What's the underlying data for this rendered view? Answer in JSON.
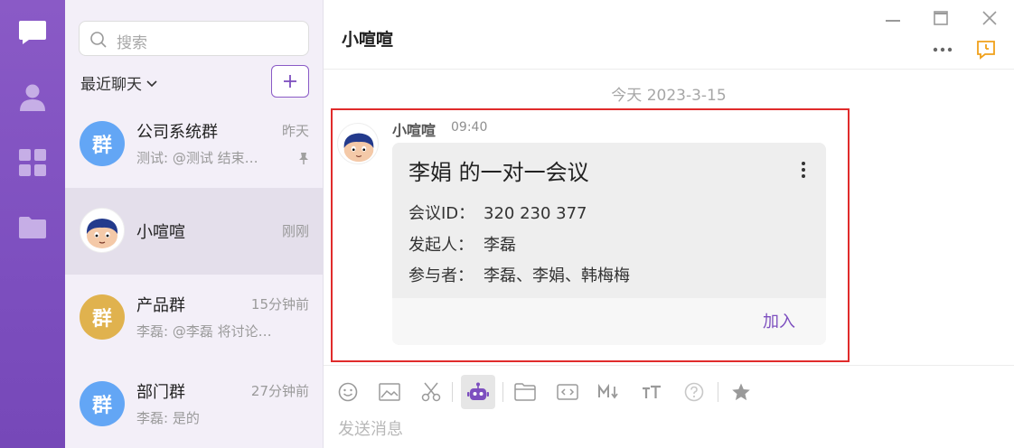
{
  "sidebar": {
    "items": [
      {
        "icon": "chat-icon"
      },
      {
        "icon": "contacts-icon"
      },
      {
        "icon": "apps-icon"
      },
      {
        "icon": "folder-icon"
      }
    ]
  },
  "conversation_list": {
    "search_placeholder": "搜索",
    "filter_label": "最近聊天",
    "add_label": "+",
    "conversations": [
      {
        "avatar_text": "群",
        "avatar_color": "#63a6f5",
        "name": "公司系统群",
        "time": "昨天",
        "preview": "测试: @测试 结束…",
        "pinned": true
      },
      {
        "avatar_text": "",
        "avatar_color": "#ffffff",
        "name": "小喧喧",
        "time": "刚刚",
        "preview": "",
        "active": true
      },
      {
        "avatar_text": "群",
        "avatar_color": "#e0b24e",
        "name": "产品群",
        "time": "15分钟前",
        "preview": "李磊: @李磊 将讨论…"
      },
      {
        "avatar_text": "群",
        "avatar_color": "#63a6f5",
        "name": "部门群",
        "time": "27分钟前",
        "preview": "李磊: 是的"
      }
    ]
  },
  "chat": {
    "title": "小喧喧",
    "date_divider": "今天 2023-3-15",
    "message": {
      "sender": "小喧喧",
      "time": "09:40",
      "card": {
        "title": "李娟 的一对一会议",
        "rows": [
          {
            "label": "会议ID：",
            "value": "320 230 377"
          },
          {
            "label": "发起人：",
            "value": "李磊"
          },
          {
            "label": "参与者：",
            "value": "李磊、李娟、韩梅梅"
          }
        ],
        "action": "加入"
      }
    },
    "input_placeholder": "发送消息",
    "toolbar": [
      "emoji-icon",
      "image-icon",
      "scissors-icon",
      "robot-icon",
      "folder-icon",
      "code-icon",
      "markdown-icon",
      "text-size-icon",
      "help-icon",
      "star-icon"
    ]
  },
  "colors": {
    "brand": "#7d4fbf",
    "highlight_border": "#e02b2b",
    "reminder": "#f0a01a"
  }
}
